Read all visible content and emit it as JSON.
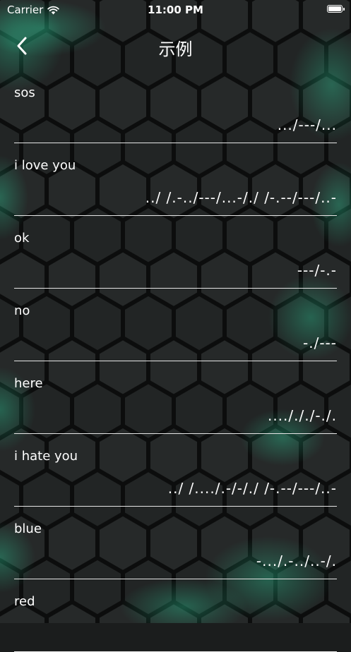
{
  "status_bar": {
    "carrier": "Carrier",
    "time": "11:00 PM"
  },
  "nav": {
    "title": "示例"
  },
  "items": [
    {
      "word": "sos",
      "code": ".../---/..."
    },
    {
      "word": "i love you",
      "code": "../ /.-../---/...-/./ /-.--/---/..-"
    },
    {
      "word": "ok",
      "code": "---/-.-"
    },
    {
      "word": "no",
      "code": "-./---"
    },
    {
      "word": "here",
      "code": "..../././-./."
    },
    {
      "word": "i hate you",
      "code": "../ /..../.-/-/./ /-.--/---/..-"
    },
    {
      "word": "blue",
      "code": "-.../.-../..-/."
    },
    {
      "word": "red",
      "code": ""
    }
  ],
  "colors": {
    "background": "#1b1d1d",
    "hex_glow": "#2fd6a0",
    "text": "#ffffff",
    "divider": "#e6e6e6"
  }
}
